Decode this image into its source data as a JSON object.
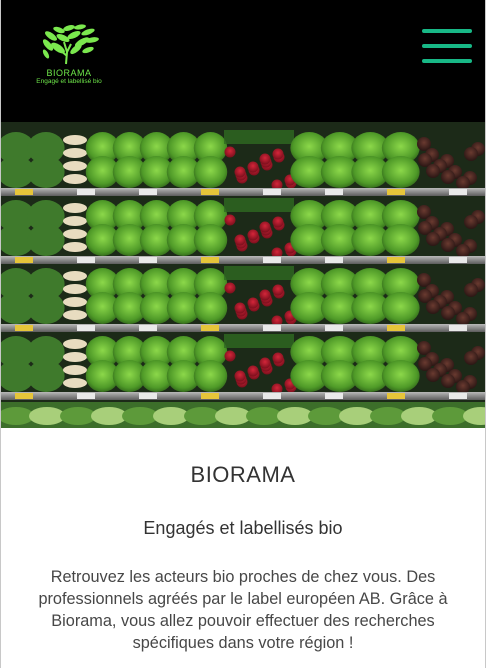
{
  "header": {
    "brand_name": "BIORAMA",
    "tagline": "Engagé et labellisé bio",
    "logo_icon": "leaf-tree-icon",
    "menu_icon": "hamburger-menu-icon",
    "accent_green": "#6ee64a",
    "menu_color": "#18b886",
    "background": "#000000"
  },
  "hero": {
    "image": "vegetable-market-shelves"
  },
  "content": {
    "title": "BIORAMA",
    "subtitle": "Engagés et labellisés bio",
    "description": "Retrouvez les acteurs bio proches de chez vous. Des professionnels agréés par le label européen AB. Grâce à Biorama, vous allez pouvoir effectuer des recherches spécifiques dans votre région !"
  }
}
